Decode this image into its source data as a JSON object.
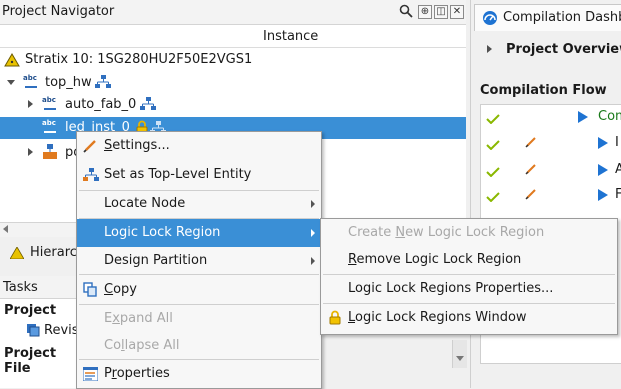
{
  "navigator": {
    "title": "Project Navigator",
    "column_header": "Instance",
    "device": "Stratix 10: 1SG280HU2F50E2VGS1",
    "tree": [
      {
        "label": "top_hw"
      },
      {
        "label": "auto_fab_0"
      },
      {
        "label": "led_inst_0"
      },
      {
        "label": "po"
      }
    ],
    "hierarchy_tab": "Hierarc",
    "tasks_title": "Tasks",
    "tasks": {
      "project": "Project",
      "revisions": "Revis",
      "project_files": "Project File"
    }
  },
  "dashboard": {
    "tab_label": "Compilation Dashb",
    "project_overview": "Project Overview",
    "flow_title": "Compilation Flow",
    "flow_rows": [
      {
        "label": "Com"
      },
      {
        "label": "I"
      },
      {
        "label": "A"
      },
      {
        "label": "F"
      }
    ]
  },
  "context_menu": {
    "items": [
      {
        "label": "Settings...",
        "mnemonic": "S",
        "rest": "ettings..."
      },
      {
        "label": "Set as Top-Level Entity"
      },
      {
        "label": "Locate Node"
      },
      {
        "label": "Logic Lock Region"
      },
      {
        "label": "Design Partition"
      },
      {
        "label": "Copy",
        "mnemonic": "C",
        "rest": "opy"
      },
      {
        "label": "Expand All",
        "pre": "E",
        "mnemonic": "x",
        "rest": "pand All"
      },
      {
        "label": "Collapse All",
        "pre": "Co",
        "mnemonic": "l",
        "rest": "lapse All"
      },
      {
        "label": "Properties",
        "pre": "P",
        "mnemonic": "r",
        "rest": "operties"
      }
    ]
  },
  "submenu": {
    "items": [
      {
        "label": "Create New Logic Lock Region",
        "pre": "Create ",
        "mnemonic": "N",
        "rest": "ew Logic Lock Region"
      },
      {
        "label": "Remove Logic Lock Region",
        "mnemonic": "R",
        "rest": "emove Logic Lock Region"
      },
      {
        "label": "Logic Lock Regions Properties...",
        "pre": "Logic Lock Regions Properties",
        "mnemonic": "",
        "rest": "..."
      },
      {
        "label": "Logic Lock Regions Window",
        "mnemonic": "L",
        "rest": "ogic Lock Regions Window"
      }
    ]
  },
  "colors": {
    "selection": "#3a8fd6",
    "check": "#8ab800",
    "play": "#1e73d2"
  }
}
